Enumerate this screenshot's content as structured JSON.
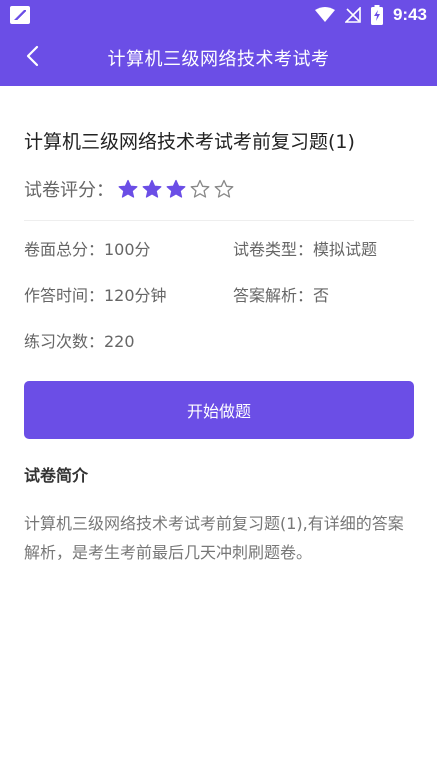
{
  "status_bar": {
    "time": "9:43",
    "icons": [
      "wifi-icon",
      "no-signal-icon",
      "battery-charging-icon"
    ]
  },
  "header": {
    "title": "计算机三级网络技术考试考",
    "back_icon": "chevron-left-icon",
    "color": "#6b4ee6"
  },
  "paper": {
    "title": "计算机三级网络技术考试考前复习题(1)",
    "rating_label": "试卷评分：",
    "rating": 3,
    "rating_max": 5,
    "star_color": "#6b4ee6"
  },
  "meta": {
    "total_score": "卷面总分：100分",
    "paper_type": "试卷类型：模拟试题",
    "time_limit": "作答时间：120分钟",
    "answer_analysis": "答案解析：否",
    "practice_count": "练习次数：220"
  },
  "actions": {
    "start_label": "开始做题"
  },
  "intro": {
    "heading": "试卷简介",
    "body": "计算机三级网络技术考试考前复习题(1),有详细的答案解析，是考生考前最后几天冲刺刷题卷。"
  }
}
